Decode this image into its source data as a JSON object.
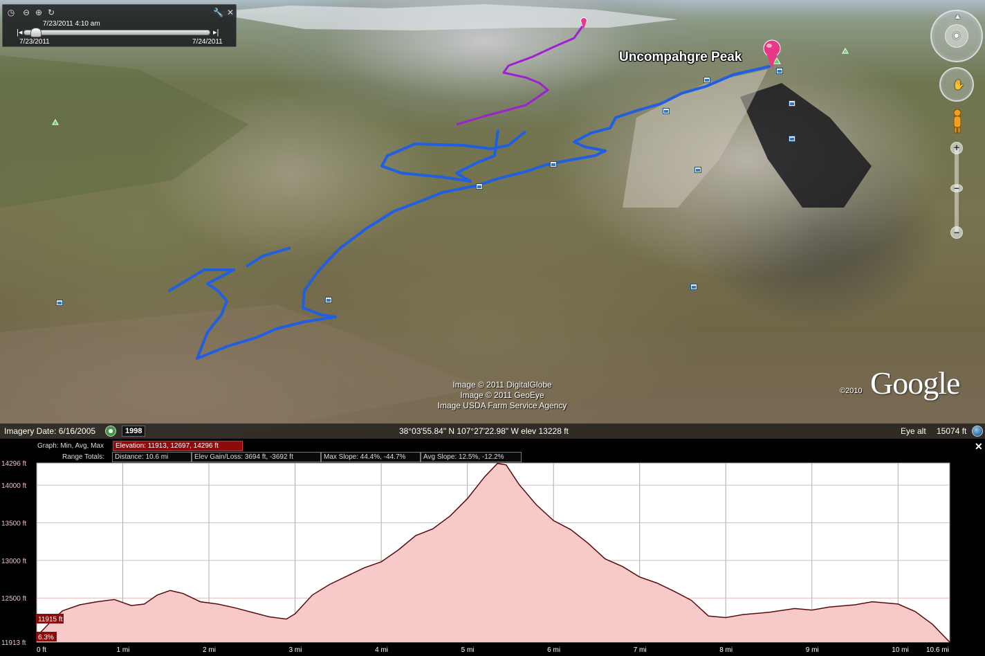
{
  "map": {
    "placemark_label": "Uncompahgre Peak",
    "imagery_credits": [
      "Image © 2011 DigitalGlobe",
      "Image © 2011 GeoEye",
      "Image USDA Farm Service Agency"
    ],
    "copyright_year": "©2010",
    "logo_text": "Google",
    "track_color": "#1f5fe0",
    "secondary_track_color": "#a020d0",
    "placemark_color": "#e8388a"
  },
  "time_slider": {
    "current": "7/23/2011   4:10 am",
    "start": "7/23/2011",
    "end": "7/24/2011"
  },
  "status_bar": {
    "imagery_date": "Imagery Date: 6/16/2005",
    "history_year": "1998",
    "coordinates": "38°03'55.84\" N  107°27'22.98\" W  elev 13228 ft",
    "eye_alt_label": "Eye alt",
    "eye_alt_value": "15074 ft"
  },
  "profile": {
    "graph_label": "Graph: Min, Avg, Max",
    "elevation_stat": "Elevation: 11913, 12697, 14296 ft",
    "range_totals_label": "Range Totals:",
    "distance": "Distance: 10.6 mi",
    "elev_gain_loss": "Elev Gain/Loss: 3694 ft, -3692 ft",
    "max_slope": "Max Slope: 44.4%, -44.7%",
    "avg_slope": "Avg Slope: 12.5%, -12.2%",
    "close_label": "✕"
  },
  "chart_data": {
    "type": "area",
    "title": "",
    "xlabel": "",
    "ylabel": "",
    "x_unit": "mi",
    "y_unit": "ft",
    "xlim": [
      0,
      10.6
    ],
    "ylim": [
      11913,
      14296
    ],
    "x_ticks": [
      "0 ft",
      "1 mi",
      "2 mi",
      "3 mi",
      "4 mi",
      "5 mi",
      "6 mi",
      "7 mi",
      "8 mi",
      "9 mi",
      "10 mi",
      "10.6 mi"
    ],
    "y_ticks": [
      "14296 ft",
      "14000 ft",
      "13500 ft",
      "13000 ft",
      "12500 ft",
      "11913 ft"
    ],
    "cursor": {
      "elevation": "11915 ft",
      "slope": "6.3%"
    },
    "fill_color": "#f7c9c9",
    "line_color": "#5a0a0a",
    "series": [
      {
        "x": [
          0,
          0.15,
          0.3,
          0.5,
          0.7,
          0.9,
          1.1,
          1.25,
          1.4,
          1.55,
          1.7,
          1.9,
          2.1,
          2.3,
          2.5,
          2.7,
          2.9,
          3.0,
          3.2,
          3.4,
          3.6,
          3.8,
          4.0,
          4.2,
          4.4,
          4.6,
          4.8,
          5.0,
          5.2,
          5.35,
          5.45,
          5.6,
          5.8,
          6.0,
          6.2,
          6.4,
          6.6,
          6.8,
          7.0,
          7.2,
          7.4,
          7.6,
          7.8,
          8.0,
          8.2,
          8.5,
          8.8,
          9.0,
          9.2,
          9.5,
          9.7,
          10.0,
          10.2,
          10.4,
          10.6
        ],
        "y": [
          11990,
          12170,
          12330,
          12410,
          12450,
          12480,
          12400,
          12420,
          12540,
          12600,
          12560,
          12450,
          12420,
          12370,
          12310,
          12250,
          12220,
          12290,
          12540,
          12680,
          12790,
          12900,
          12980,
          13140,
          13330,
          13420,
          13590,
          13820,
          14110,
          14290,
          14270,
          14010,
          13740,
          13530,
          13410,
          13230,
          13020,
          12920,
          12780,
          12700,
          12590,
          12470,
          12260,
          12240,
          12280,
          12310,
          12360,
          12340,
          12380,
          12410,
          12450,
          12420,
          12320,
          12150,
          11913
        ]
      }
    ]
  }
}
